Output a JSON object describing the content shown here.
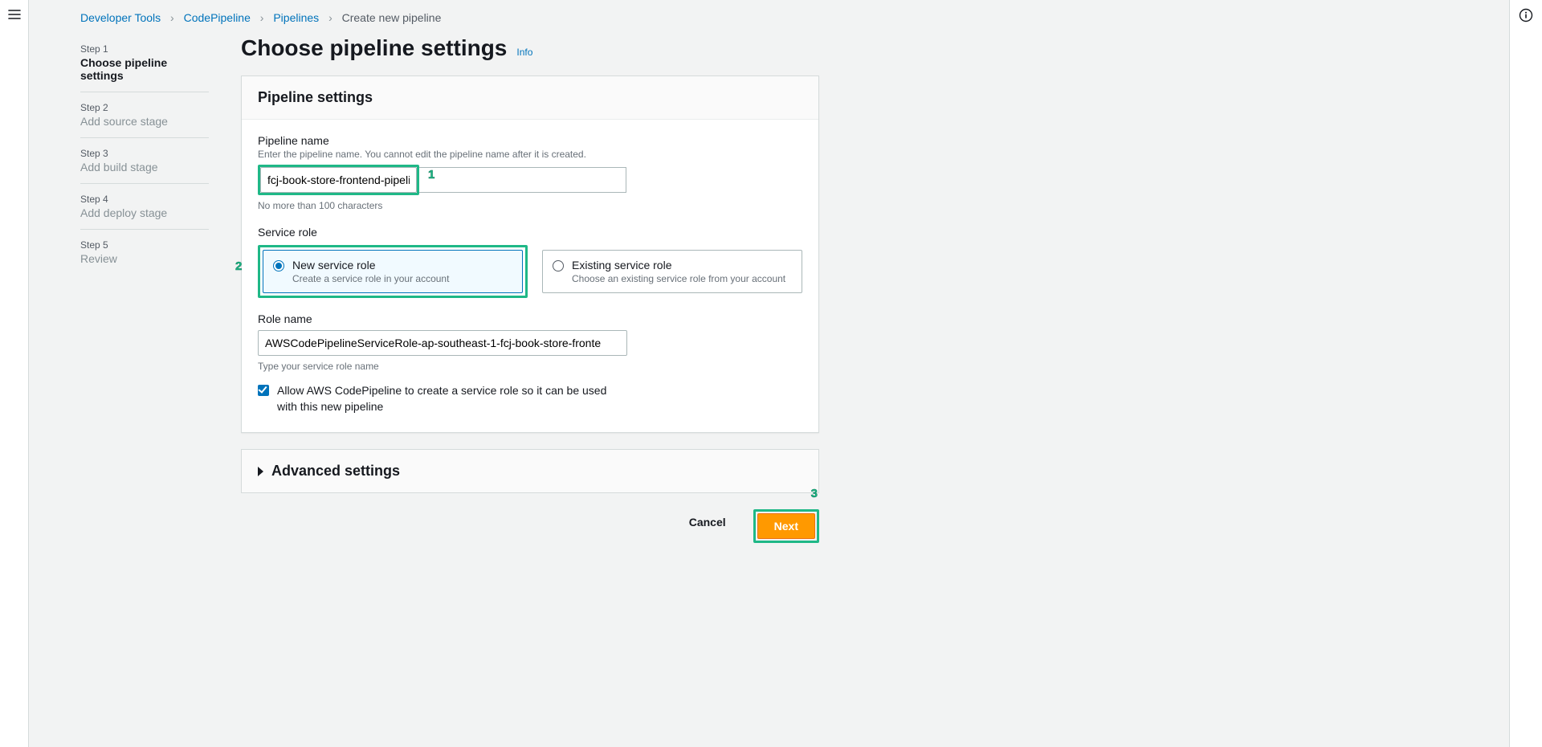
{
  "breadcrumbs": {
    "items": [
      "Developer Tools",
      "CodePipeline",
      "Pipelines"
    ],
    "current": "Create new pipeline"
  },
  "steps": [
    {
      "label": "Step 1",
      "title": "Choose pipeline settings",
      "active": true
    },
    {
      "label": "Step 2",
      "title": "Add source stage",
      "active": false
    },
    {
      "label": "Step 3",
      "title": "Add build stage",
      "active": false
    },
    {
      "label": "Step 4",
      "title": "Add deploy stage",
      "active": false
    },
    {
      "label": "Step 5",
      "title": "Review",
      "active": false
    }
  ],
  "page": {
    "title": "Choose pipeline settings",
    "info": "Info"
  },
  "panel": {
    "header": "Pipeline settings",
    "pipeline_name": {
      "label": "Pipeline name",
      "desc": "Enter the pipeline name. You cannot edit the pipeline name after it is created.",
      "value": "fcj-book-store-frontend-pipeline",
      "help": "No more than 100 characters"
    },
    "service_role": {
      "label": "Service role",
      "options": {
        "new": {
          "title": "New service role",
          "desc": "Create a service role in your account"
        },
        "existing": {
          "title": "Existing service role",
          "desc": "Choose an existing service role from your account"
        }
      }
    },
    "role_name": {
      "label": "Role name",
      "value": "AWSCodePipelineServiceRole-ap-southeast-1-fcj-book-store-fronte",
      "help": "Type your service role name"
    },
    "allow_checkbox": "Allow AWS CodePipeline to create a service role so it can be used with this new pipeline"
  },
  "advanced": {
    "title": "Advanced settings"
  },
  "actions": {
    "cancel": "Cancel",
    "next": "Next"
  },
  "callouts": {
    "one": "1",
    "two": "2",
    "three": "3"
  }
}
